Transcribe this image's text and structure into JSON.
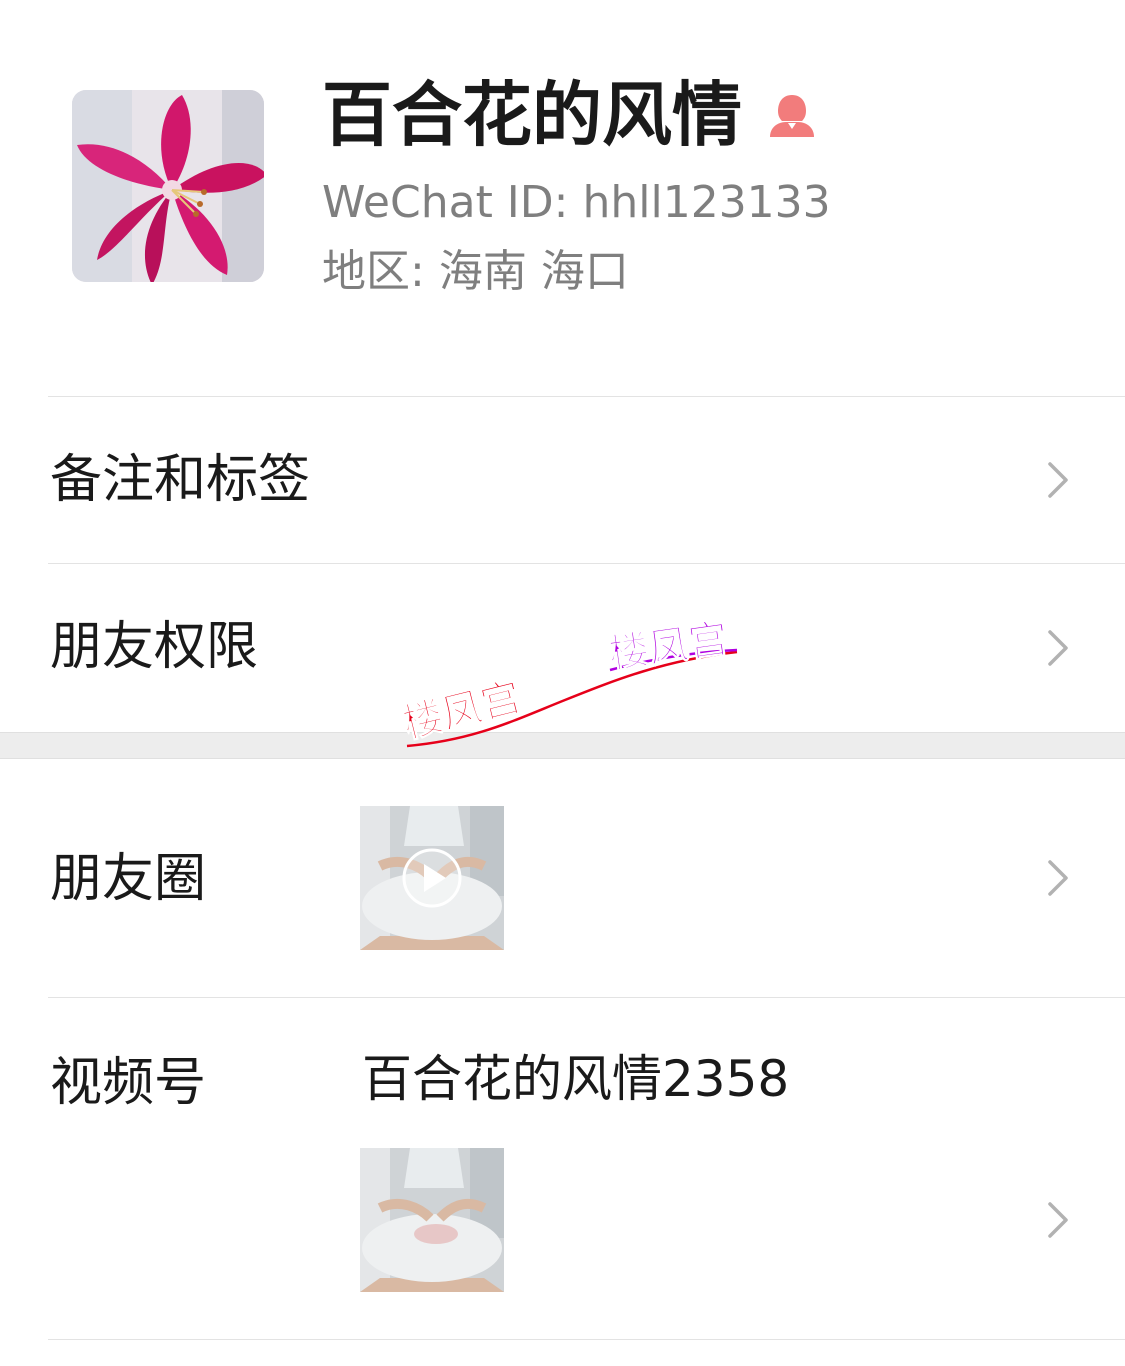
{
  "profile": {
    "name": "百合花的风情",
    "wechat_id": "WeChat ID: hhll123133",
    "region_label": "地区:",
    "region_province": "海南",
    "region_city": "海口",
    "gender_icon": "female-person-icon",
    "gender_color": "#f27c7c"
  },
  "rows": {
    "remarks": {
      "label": "备注和标签"
    },
    "permissions": {
      "label": "朋友权限"
    },
    "moments": {
      "label": "朋友圈"
    },
    "channels": {
      "label": "视频号",
      "channel_name": "百合花的风情2358"
    }
  },
  "watermark": {
    "text_1": "楼凤宫",
    "text_2": "楼凤宫",
    "color_1": "#e6001a",
    "color_2": "#b000e0"
  },
  "colors": {
    "secondary_text": "#7f7f7f",
    "separator_band": "#ededed"
  }
}
